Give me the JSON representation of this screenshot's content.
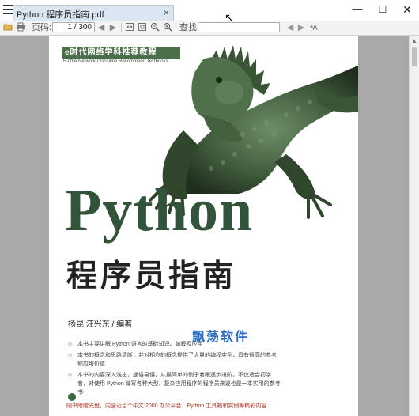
{
  "tab": {
    "title": "Python 程序员指南.pdf",
    "close_glyph": "×"
  },
  "window_controls": {
    "minimize": "—",
    "maximize": "☐",
    "close": "✕"
  },
  "toolbar": {
    "page_label": "页码:",
    "page_current": "1",
    "page_total": " / 300",
    "find_label": "查找:",
    "find_placeholder": ""
  },
  "document": {
    "series_banner": "e时代网络学科推荐教程",
    "series_subtitle": "E-time Network Discipline Recommend Textbooks",
    "title_latin": "Python",
    "title_cn": "程序员指南",
    "authors": "杨昆    汪兴东  / 编著",
    "bullets": [
      "本书主要讲解 Python 语言的基础知识、编程及应用",
      "本书的概念和思路清晰，并对相应的概念提供了大量的编程实例，具有很高的参考和应用价值",
      "本书的内容深入浅出，通俗易懂，从最简单的例子着眼逐步进阶，不仅适合初学者，对使用 Python 编写各种大型、复杂应用程序的程序员来说也是一本实用的参考书"
    ],
    "footer_note": "随书附赠光盘，内含近百个中文 2000 办公平台，Python 工具箱和实例等精彩内容"
  },
  "watermark": "飘荡软件",
  "colors": {
    "title_green": "#31543a",
    "banner_green": "#4d6e4a",
    "viewer_gray": "#a8a8a8",
    "tab_blue": "#dbe6f3",
    "watermark_blue": "#2b6cc4",
    "footer_red": "#b03020"
  }
}
